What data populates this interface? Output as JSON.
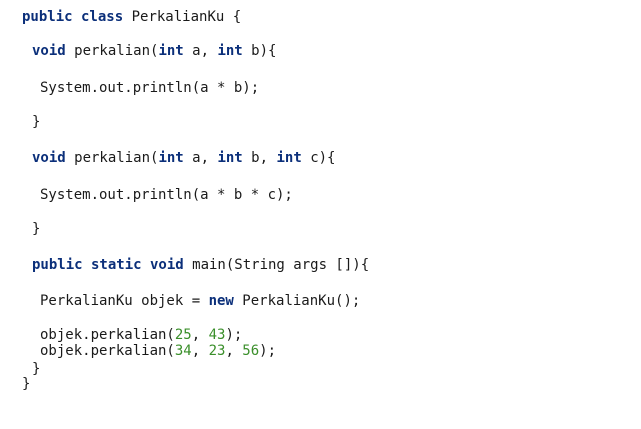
{
  "code": {
    "lines": [
      [
        {
          "t": "public class",
          "k": "kw"
        },
        {
          "t": " PerkalianKu {",
          "k": "plain"
        }
      ],
      [
        {
          "t": "void",
          "k": "kw"
        },
        {
          "t": " perkalian(",
          "k": "plain"
        },
        {
          "t": "int",
          "k": "kw"
        },
        {
          "t": " a, ",
          "k": "plain"
        },
        {
          "t": "int",
          "k": "kw"
        },
        {
          "t": " b){",
          "k": "plain"
        }
      ],
      [
        {
          "t": "System.out.println(a * b);",
          "k": "plain"
        }
      ],
      [
        {
          "t": "}",
          "k": "plain"
        }
      ],
      [
        {
          "t": "void",
          "k": "kw"
        },
        {
          "t": " perkalian(",
          "k": "plain"
        },
        {
          "t": "int",
          "k": "kw"
        },
        {
          "t": " a, ",
          "k": "plain"
        },
        {
          "t": "int",
          "k": "kw"
        },
        {
          "t": " b, ",
          "k": "plain"
        },
        {
          "t": "int",
          "k": "kw"
        },
        {
          "t": " c){",
          "k": "plain"
        }
      ],
      [
        {
          "t": "System.out.println(a * b * c);",
          "k": "plain"
        }
      ],
      [
        {
          "t": "}",
          "k": "plain"
        }
      ],
      [
        {
          "t": "public static void",
          "k": "kw"
        },
        {
          "t": " main(String args []){",
          "k": "plain"
        }
      ],
      [
        {
          "t": "PerkalianKu objek = ",
          "k": "plain"
        },
        {
          "t": "new",
          "k": "kw"
        },
        {
          "t": " PerkalianKu();",
          "k": "plain"
        }
      ],
      [
        {
          "t": "objek.perkalian(",
          "k": "plain"
        },
        {
          "t": "25",
          "k": "num"
        },
        {
          "t": ", ",
          "k": "plain"
        },
        {
          "t": "43",
          "k": "num"
        },
        {
          "t": ");",
          "k": "plain"
        }
      ],
      [
        {
          "t": "objek.perkalian(",
          "k": "plain"
        },
        {
          "t": "34",
          "k": "num"
        },
        {
          "t": ", ",
          "k": "plain"
        },
        {
          "t": "23",
          "k": "num"
        },
        {
          "t": ", ",
          "k": "plain"
        },
        {
          "t": "56",
          "k": "num"
        },
        {
          "t": ");",
          "k": "plain"
        }
      ],
      [
        {
          "t": "}",
          "k": "plain"
        }
      ],
      [
        {
          "t": "}",
          "k": "plain"
        }
      ]
    ]
  },
  "colors": {
    "keyword": "#0b2f7a",
    "number": "#3a8f2a",
    "text": "#1a1a1a",
    "background": "#ffffff"
  }
}
